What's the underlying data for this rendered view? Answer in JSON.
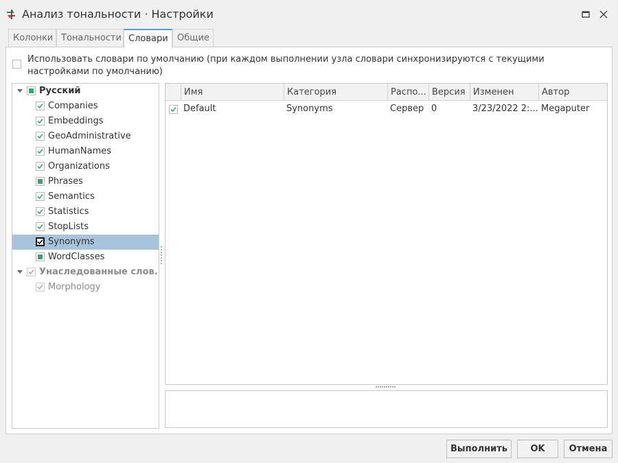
{
  "window": {
    "title": "Анализ тональности · Настройки"
  },
  "tabs": [
    {
      "label": "Колонки",
      "active": false
    },
    {
      "label": "Тональности",
      "active": false
    },
    {
      "label": "Словари",
      "active": true
    },
    {
      "label": "Общие",
      "active": false
    }
  ],
  "use_default": {
    "label": "Использовать словари по умолчанию (при каждом выполнении узла словари синхронизируются с текущими настройками по умолчанию)",
    "checked": false
  },
  "tree": {
    "groups": [
      {
        "label": "Русский",
        "state": "partial",
        "items": [
          {
            "label": "Companies",
            "state": "checked"
          },
          {
            "label": "Embeddings",
            "state": "checked"
          },
          {
            "label": "GeoAdministrative",
            "state": "checked"
          },
          {
            "label": "HumanNames",
            "state": "checked"
          },
          {
            "label": "Organizations",
            "state": "checked"
          },
          {
            "label": "Phrases",
            "state": "partial"
          },
          {
            "label": "Semantics",
            "state": "checked"
          },
          {
            "label": "Statistics",
            "state": "checked"
          },
          {
            "label": "StopLists",
            "state": "checked"
          },
          {
            "label": "Synonyms",
            "state": "checked",
            "selected": true
          },
          {
            "label": "WordClasses",
            "state": "partial"
          }
        ]
      },
      {
        "label": "Унаследованные слов...",
        "state": "disabled-checked",
        "items": [
          {
            "label": "Morphology",
            "state": "disabled-checked"
          }
        ]
      }
    ]
  },
  "grid": {
    "columns": [
      "Имя",
      "Категория",
      "Распо...",
      "Версия",
      "Изменен",
      "Автор"
    ],
    "rows": [
      {
        "checked": true,
        "cells": [
          "Default",
          "Synonyms",
          "Сервер",
          "0",
          "3/23/2022 2:...",
          "Megaputer"
        ]
      }
    ]
  },
  "buttons": {
    "run": "Выполнить",
    "ok": "OK",
    "cancel": "Отмена"
  },
  "colors": {
    "accent": "#5b9bd5",
    "check": "#3aa56a",
    "selection": "#a8c4dc"
  }
}
